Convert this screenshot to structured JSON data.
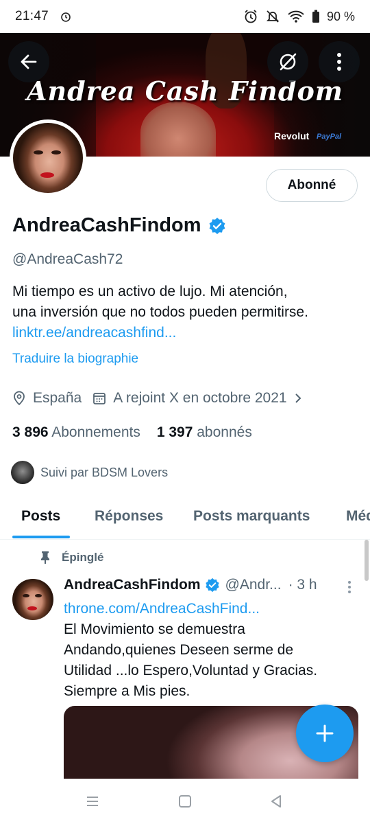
{
  "status_bar": {
    "time": "21:47",
    "battery": "90 %"
  },
  "banner": {
    "title": "Andrea Cash Findom",
    "brand_1": "Revolut",
    "brand_2": "PayPal"
  },
  "profile": {
    "follow_label": "Abonné",
    "name": "AndreaCashFindom",
    "handle": "@AndreaCash72",
    "bio_line1": "Mi tiempo es un activo de lujo. Mi atención,",
    "bio_line2": "una inversión que no todos pueden permitirse.",
    "bio_link": "linktr.ee/andreacashfind...",
    "translate": "Traduire la biographie",
    "location": "España",
    "joined": "A rejoint X en octobre 2021",
    "following_count": "3 896",
    "following_label": "Abonnements",
    "followers_count": "1 397",
    "followers_label": "abonnés",
    "followed_by": "Suivi par BDSM Lovers"
  },
  "tabs": [
    "Posts",
    "Réponses",
    "Posts marquants",
    "Médias"
  ],
  "post": {
    "pinned_label": "Épinglé",
    "name": "AndreaCashFindom",
    "handle": "@Andr...",
    "time": "· 3 h",
    "link": "throne.com/AndreaCashFind...",
    "text_line1": "El Movimiento se demuestra",
    "text_line2": "Andando,quienes Deseen serme de",
    "text_line3": "Utilidad ...lo Espero,Voluntad y Gracias.",
    "text_line4": "Siempre a Mis pies."
  },
  "colors": {
    "accent": "#1d9bf0",
    "text": "#0f1419",
    "secondary": "#536471",
    "border": "#cfd9de"
  },
  "icons": [
    "alarm-icon",
    "mute-icon",
    "wifi-icon",
    "battery-icon",
    "back-arrow-icon",
    "grok-icon",
    "more-icon",
    "verified-icon",
    "location-icon",
    "calendar-icon",
    "chevron-right-icon",
    "pin-icon",
    "plus-icon"
  ]
}
